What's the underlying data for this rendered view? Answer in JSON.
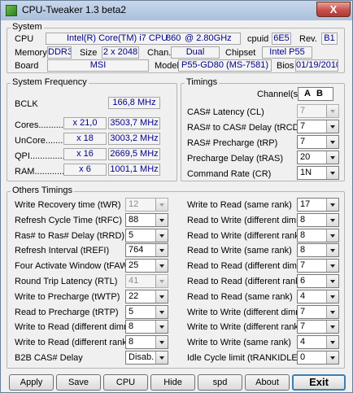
{
  "window": {
    "title": "CPU-Tweaker 1.3 beta2",
    "close_label": "X"
  },
  "system": {
    "legend": "System",
    "cpu_label": "CPU",
    "cpu_name": "Intel(R) Core(TM) i7 CPU",
    "cpu_model": "860",
    "cpu_freq": "@ 2.80GHz",
    "cpuid_label": "cpuid",
    "cpuid": "6E5",
    "rev_label": "Rev.",
    "rev": "B1",
    "memory_label": "Memory",
    "memory_type": "DDR3",
    "size_label": "Size",
    "size": "2 x 2048",
    "chan_label": "Chan.",
    "chan": "Dual",
    "chipset_label": "Chipset",
    "chipset": "Intel P55",
    "board_label": "Board",
    "board": "MSI",
    "model_label": "Model",
    "model": "P55-GD80 (MS-7581)",
    "bios_label": "Bios",
    "bios": "01/19/2010"
  },
  "frequency": {
    "legend": "System Frequency",
    "bclk_label": "BCLK",
    "bclk": "166,8 MHz",
    "rows": [
      {
        "label": "Cores",
        "mult": "x 21,0",
        "value": "3503,7 MHz"
      },
      {
        "label": "UnCore",
        "mult": "x 18",
        "value": "3003,2 MHz"
      },
      {
        "label": "QPI",
        "mult": "x 16",
        "value": "2669,5 MHz"
      },
      {
        "label": "RAM",
        "mult": "x 6",
        "value": "1001,1 MHz"
      }
    ]
  },
  "timings": {
    "legend": "Timings",
    "channel_label": "Channel(s)",
    "channel_a": "A",
    "channel_b": "B",
    "rows": [
      {
        "label": "CAS# Latency (CL)",
        "value": "7",
        "disabled": true
      },
      {
        "label": "RAS# to CAS# Delay (tRCD)",
        "value": "7",
        "disabled": false
      },
      {
        "label": "RAS# Precharge (tRP)",
        "value": "7",
        "disabled": false
      },
      {
        "label": "Precharge Delay (tRAS)",
        "value": "20",
        "disabled": false
      },
      {
        "label": "Command Rate (CR)",
        "value": "1N",
        "disabled": false
      }
    ]
  },
  "others": {
    "legend": "Others Timings",
    "left": [
      {
        "label": "Write Recovery time (tWR)",
        "value": "12",
        "disabled": true
      },
      {
        "label": "Refresh Cycle Time (tRFC)",
        "value": "88",
        "disabled": false
      },
      {
        "label": "Ras# to Ras# Delay (tRRD)",
        "value": "5",
        "disabled": false
      },
      {
        "label": "Refresh Interval (tREFI)",
        "value": "764",
        "disabled": false
      },
      {
        "label": "Four Activate Window (tFAW)",
        "value": "25",
        "disabled": false
      },
      {
        "label": "Round Trip Latency (RTL)",
        "value": "41",
        "disabled": true
      },
      {
        "label": "Write to Precharge (tWTP)",
        "value": "22",
        "disabled": false
      },
      {
        "label": "Read to Precharge (tRTP)",
        "value": "5",
        "disabled": false
      },
      {
        "label": "Write to Read (different dimms)",
        "value": "8",
        "disabled": false
      },
      {
        "label": "Write to Read (different ranks)",
        "value": "8",
        "disabled": false
      },
      {
        "label": "B2B CAS# Delay",
        "value": "Disab.",
        "disabled": false
      }
    ],
    "right": [
      {
        "label": "Write to Read (same rank)",
        "value": "17",
        "disabled": false
      },
      {
        "label": "Read to Write (different dimms)",
        "value": "8",
        "disabled": false
      },
      {
        "label": "Read to Write (different ranks)",
        "value": "8",
        "disabled": false
      },
      {
        "label": "Read to Write (same rank)",
        "value": "8",
        "disabled": false
      },
      {
        "label": "Read to Read (different dimms)",
        "value": "7",
        "disabled": false
      },
      {
        "label": "Read to Read (different ranks)",
        "value": "6",
        "disabled": false
      },
      {
        "label": "Read to Read (same rank)",
        "value": "4",
        "disabled": false
      },
      {
        "label": "Write to Write (different dimms)",
        "value": "7",
        "disabled": false
      },
      {
        "label": "Write to Write (different ranks)",
        "value": "7",
        "disabled": false
      },
      {
        "label": "Write to Write (same rank)",
        "value": "4",
        "disabled": false
      },
      {
        "label": "Idle Cycle limit (tRANKIDLE)",
        "value": "0",
        "disabled": false
      }
    ]
  },
  "buttons": {
    "apply": "Apply",
    "save": "Save",
    "cpu": "CPU",
    "hide": "Hide",
    "spd": "spd",
    "about": "About",
    "exit": "Exit"
  }
}
